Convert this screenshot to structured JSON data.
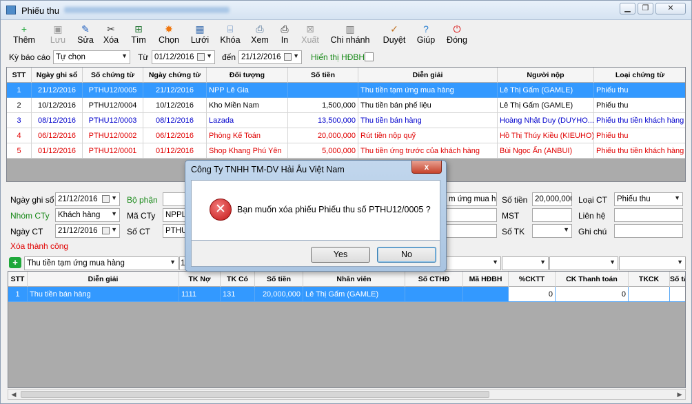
{
  "window": {
    "title": "Phiếu thu",
    "minimize": "▁",
    "restore": "❐",
    "close": "✕"
  },
  "toolbar": [
    {
      "label": "Thêm",
      "icon": "add-icon",
      "glyph": "+",
      "color": "#1fa83a",
      "enabled": true
    },
    {
      "label": "Lưu",
      "icon": "save-icon",
      "glyph": "▣",
      "color": "#9a9a9a",
      "enabled": false
    },
    {
      "label": "Sửa",
      "icon": "edit-icon",
      "glyph": "✎",
      "color": "#2060c0",
      "enabled": true
    },
    {
      "label": "Xóa",
      "icon": "delete-icon",
      "glyph": "✂",
      "color": "#333333",
      "enabled": true
    },
    {
      "label": "Tìm",
      "icon": "find-icon",
      "glyph": "⊞",
      "color": "#2a7a3a",
      "enabled": true
    },
    {
      "label": "Chọn",
      "icon": "select-icon",
      "glyph": "✸",
      "color": "#f07810",
      "enabled": true
    },
    {
      "label": "Lưới",
      "icon": "grid-icon",
      "glyph": "▦",
      "color": "#3d6fb0",
      "enabled": true
    },
    {
      "label": "Khóa",
      "icon": "lock-icon",
      "glyph": "⌸",
      "color": "#4a7ab8",
      "enabled": true
    },
    {
      "label": "Xem",
      "icon": "preview-icon",
      "glyph": "⎙",
      "color": "#4c6f94",
      "enabled": true
    },
    {
      "label": "In",
      "icon": "print-icon",
      "glyph": "⎙",
      "color": "#222222",
      "enabled": true
    },
    {
      "label": "Xuất",
      "icon": "export-icon",
      "glyph": "⊠",
      "color": "#a0a0a0",
      "enabled": false
    },
    {
      "label": "Chi nhánh",
      "icon": "branch-icon",
      "glyph": "▥",
      "color": "#707070",
      "enabled": true
    },
    {
      "label": "Duyệt",
      "icon": "approve-icon",
      "glyph": "✓",
      "color": "#c07020",
      "enabled": true
    },
    {
      "label": "Giúp",
      "icon": "help-icon",
      "glyph": "?",
      "color": "#2a7fd0",
      "enabled": true
    },
    {
      "label": "Đóng",
      "icon": "power-icon",
      "glyph": "⏻",
      "color": "#d81818",
      "enabled": true
    }
  ],
  "filter": {
    "ky_bao_cao_label": "Kỳ báo cáo",
    "ky_bao_cao_value": "Tự chọn",
    "tu_label": "Từ",
    "tu_value": "01/12/2016",
    "den_label": "đến",
    "den_value": "21/12/2016",
    "hien_thi_label": "Hiển thị HĐBH"
  },
  "grid": {
    "headers": [
      "STT",
      "Ngày ghi sổ",
      "Số chứng từ",
      "Ngày chứng từ",
      "Đối tượng",
      "Số tiền",
      "Diễn giải",
      "Người nộp",
      "Loại chứng từ"
    ],
    "rows": [
      {
        "stt": "1",
        "ngay_ghi_so": "21/12/2016",
        "so_chung_tu": "PTHU12/0005",
        "ngay_chung_tu": "21/12/2016",
        "doi_tuong": "NPP Lê Gia",
        "so_tien": "",
        "dien_giai": "Thu tiền tạm ứng mua hàng",
        "nguoi_nop": "Lê Thị Gấm (GAMLE)",
        "loai": "Phiếu thu"
      },
      {
        "stt": "2",
        "ngay_ghi_so": "10/12/2016",
        "so_chung_tu": "PTHU12/0004",
        "ngay_chung_tu": "10/12/2016",
        "doi_tuong": "Kho Miền Nam",
        "so_tien": "1,500,000",
        "dien_giai": "Thu tiền bán phế liệu",
        "nguoi_nop": "Lê Thị Gấm (GAMLE)",
        "loai": "Phiếu thu"
      },
      {
        "stt": "3",
        "ngay_ghi_so": "08/12/2016",
        "so_chung_tu": "PTHU12/0003",
        "ngay_chung_tu": "08/12/2016",
        "doi_tuong": "Lazada",
        "so_tien": "13,500,000",
        "dien_giai": "Thu tiền bán hàng",
        "nguoi_nop": "Hoàng Nhật Duy (DUYHO...",
        "loai": "Phiếu thu tiền khách hàng"
      },
      {
        "stt": "4",
        "ngay_ghi_so": "06/12/2016",
        "so_chung_tu": "PTHU12/0002",
        "ngay_chung_tu": "06/12/2016",
        "doi_tuong": "Phòng Kế Toán",
        "so_tien": "20,000,000",
        "dien_giai": "Rút tiền nộp quỹ",
        "nguoi_nop": "Hồ Thị Thúy Kiều (KIEUHO)",
        "loai": "Phiếu thu"
      },
      {
        "stt": "5",
        "ngay_ghi_so": "01/12/2016",
        "so_chung_tu": "PTHU12/0001",
        "ngay_chung_tu": "01/12/2016",
        "doi_tuong": "Shop Khang Phú Yên",
        "so_tien": "5,000,000",
        "dien_giai": "Thu tiền ứng trước của khách hàng",
        "nguoi_nop": "Bùi Ngọc Ẩn (ANBUI)",
        "loai": "Phiếu thu tiền khách hàng"
      }
    ]
  },
  "form": {
    "ngay_ghi_so_label": "Ngày ghi sổ",
    "ngay_ghi_so_value": "21/12/2016",
    "bo_phan_label": "Bộ phận",
    "nhom_cty_label": "Nhóm CTy",
    "nhom_cty_value": "Khách hàng",
    "ma_cty_label": "Mã CTy",
    "ma_cty_value": "NPPLE",
    "ngay_ct_label": "Ngày CT",
    "ngay_ct_value": "21/12/2016",
    "so_ct_label": "Số CT",
    "so_ct_value": "PTHU",
    "status_text": "Xóa thành công",
    "dien_giai_partial": "m ứng mua hà",
    "so_tien_label": "Số tiền",
    "so_tien_value": "20,000,000",
    "loai_ct_label": "Loại CT",
    "loai_ct_value": "Phiếu thu",
    "mst_label": "MST",
    "lien_he_label": "Liên hệ",
    "so_tk_label": "Số TK",
    "ghi_chu_label": "Ghi chú"
  },
  "detail_bar": {
    "dien_giai_value": "Thu tiền tạm ứng mua hàng",
    "partial": "1"
  },
  "detail_grid": {
    "headers": [
      "STT",
      "Diễn giải",
      "TK Nợ",
      "TK Có",
      "Số tiền",
      "Nhân viên",
      "Số CTHĐ",
      "Mã HĐBH",
      "%CKTT",
      "CK Thanh toán",
      "TKCK",
      "Số tài khoản"
    ],
    "rows": [
      {
        "stt": "1",
        "dien_giai": "Thu tiền bán hàng",
        "tk_no": "1111",
        "tk_co": "131",
        "so_tien": "20,000,000",
        "nhan_vien": "Lê Thị Gấm (GAMLE)",
        "so_cthd": "",
        "ma_hdbh": "",
        "ckt": "0",
        "ck_tt": "0",
        "tkck": "",
        "so_tk": ""
      }
    ]
  },
  "dialog": {
    "title": "Công Ty TNHH TM-DV Hải Âu Việt Nam",
    "message": "Bạn muốn xóa phiếu Phiếu thu số PTHU12/0005 ?",
    "yes": "Yes",
    "no": "No",
    "close": "x"
  }
}
